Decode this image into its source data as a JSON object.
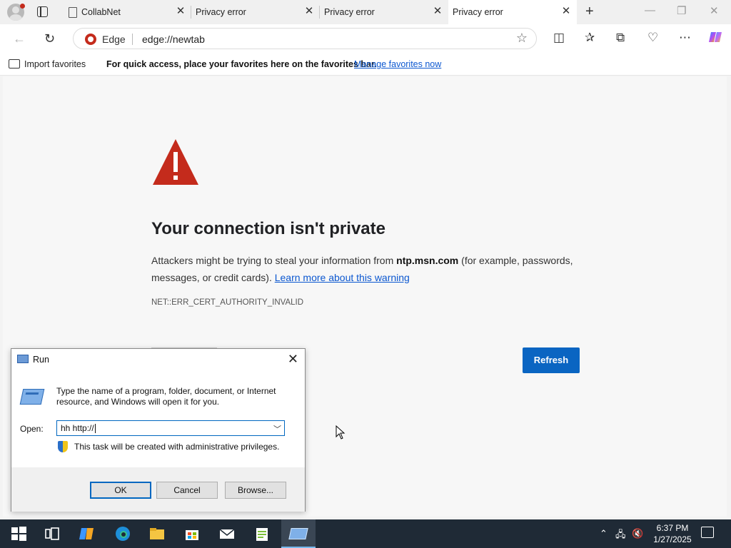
{
  "browser": {
    "tabs": [
      {
        "title": "CollabNet",
        "active": false
      },
      {
        "title": "Privacy error",
        "active": false
      },
      {
        "title": "Privacy error",
        "active": false
      },
      {
        "title": "Privacy error",
        "active": true
      }
    ],
    "address": {
      "badge_label": "Edge",
      "url": "edge://newtab"
    },
    "favorites_bar": {
      "import_label": "Import favorites",
      "message": "For quick access, place your favorites here on the favorites bar.",
      "manage_link": "Manage favorites now"
    }
  },
  "error_page": {
    "heading": "Your connection isn't private",
    "desc_before": "Attackers might be trying to steal your information from ",
    "host": "ntp.msn.com",
    "desc_after": " (for example, passwords, messages, or credit cards). ",
    "learn_more": "Learn more about this warning",
    "error_code": "NET::ERR_CERT_AUTHORITY_INVALID",
    "refresh_label": "Refresh"
  },
  "run_dialog": {
    "title": "Run",
    "description": "Type the name of a program, folder, document, or Internet resource, and Windows will open it for you.",
    "open_label": "Open:",
    "open_value": "hh http://",
    "admin_message": "This task will be created with administrative privileges.",
    "ok_label": "OK",
    "cancel_label": "Cancel",
    "browse_label": "Browse..."
  },
  "taskbar": {
    "time": "6:37 PM",
    "date": "1/27/2025"
  },
  "colors": {
    "accent": "#0a65c2",
    "warning_red": "#c42b1c",
    "taskbar": "#1f2a36"
  }
}
